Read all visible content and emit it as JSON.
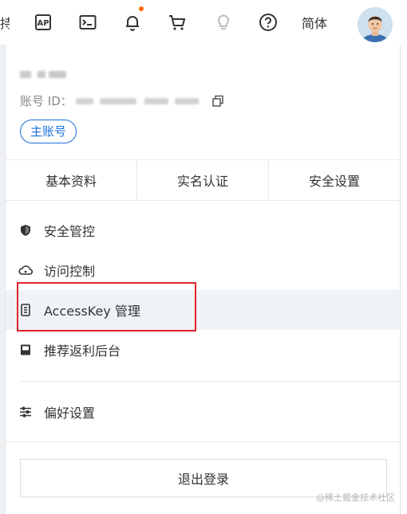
{
  "topbar": {
    "truncated_text": "持",
    "icons": [
      "api-icon",
      "terminal-icon",
      "bell-icon",
      "cart-icon",
      "bulb-icon",
      "help-icon"
    ],
    "lang_label": "简体",
    "notification_color": "#ff6a00"
  },
  "account": {
    "id_label": "账号 ID：",
    "main_account_badge": "主账号"
  },
  "tabs": [
    {
      "label": "基本资料"
    },
    {
      "label": "实名认证"
    },
    {
      "label": "安全设置"
    }
  ],
  "menu": [
    {
      "label": "安全管控",
      "icon": "shield-icon"
    },
    {
      "label": "访问控制",
      "icon": "cloud-icon"
    },
    {
      "label": "AccessKey 管理",
      "icon": "key-icon"
    },
    {
      "label": "推荐返利后台",
      "icon": "folder-icon"
    },
    {
      "label": "偏好设置",
      "icon": "sliders-icon"
    }
  ],
  "logout_label": "退出登录",
  "watermark": "@稀土掘金技术社区",
  "colors": {
    "accent": "#1a6fd8",
    "highlight": "#e0242a",
    "row_hover": "#eff3f8"
  }
}
